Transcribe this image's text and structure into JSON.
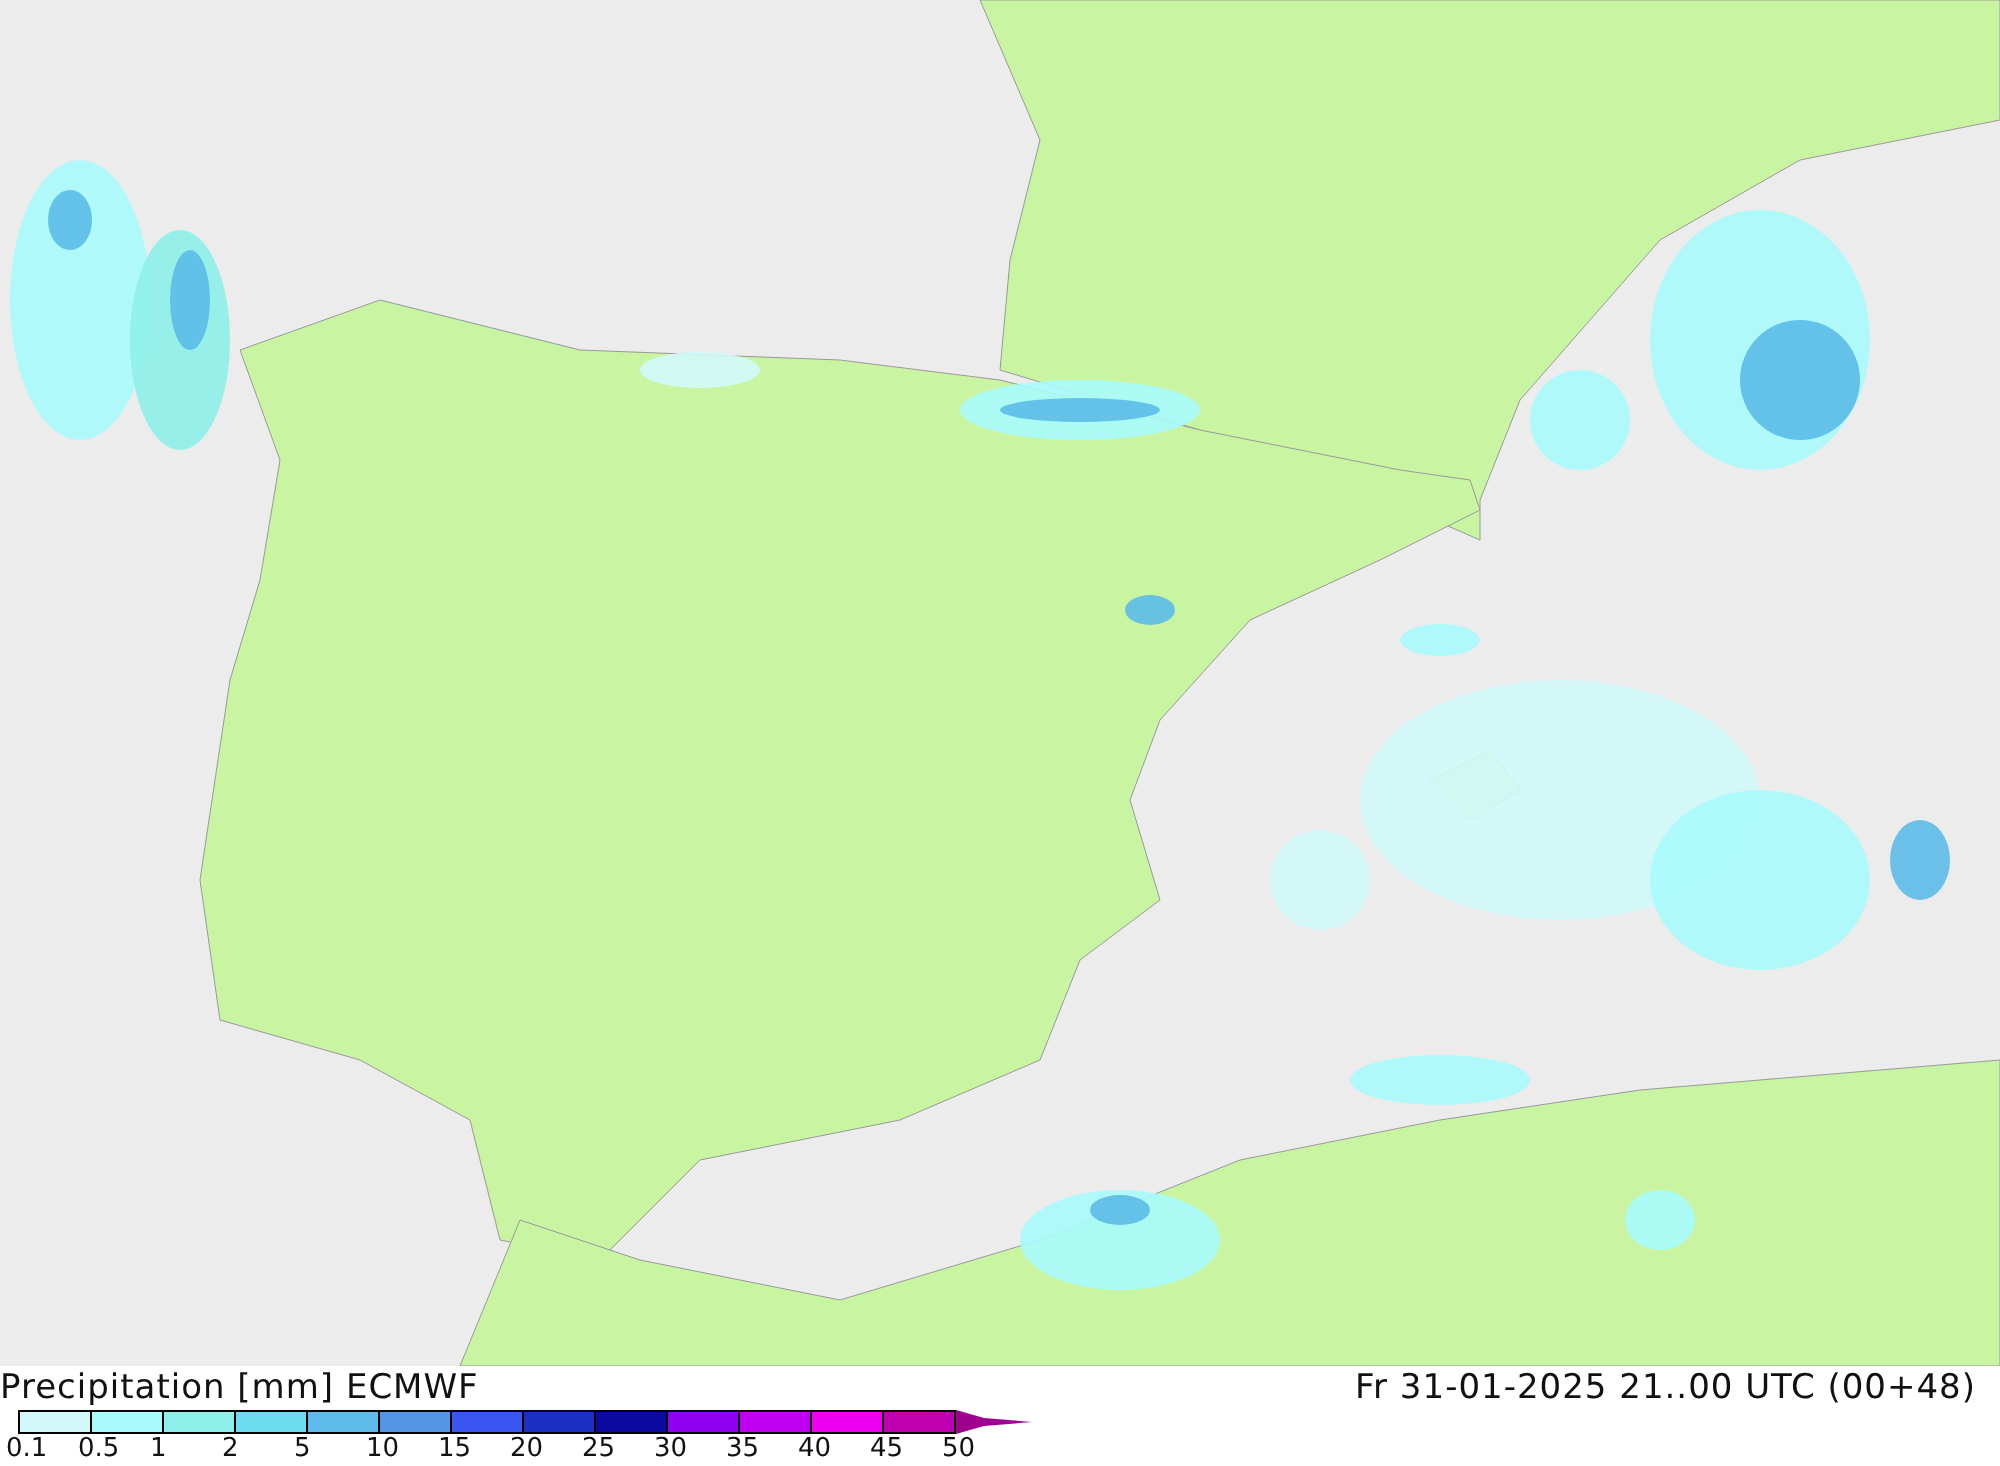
{
  "title": "Precipitation [mm] ECMWF",
  "valid_time": "Fr 31-01-2025 21..00 UTC (00+48)",
  "scale": {
    "swatches": [
      {
        "color": "#d2f8fa"
      },
      {
        "color": "#a8fbfd"
      },
      {
        "color": "#8ef0ea"
      },
      {
        "color": "#6cdcf0"
      },
      {
        "color": "#5cbbe8"
      },
      {
        "color": "#5396e6"
      },
      {
        "color": "#3a55f0"
      },
      {
        "color": "#1a30c0"
      },
      {
        "color": "#0a0aa0"
      },
      {
        "color": "#9000f0"
      },
      {
        "color": "#c000f0"
      },
      {
        "color": "#f000f0"
      },
      {
        "color": "#c000b0"
      }
    ],
    "labels": [
      "0.1",
      "0.5",
      "1",
      "2",
      "5",
      "10",
      "15",
      "20",
      "25",
      "30",
      "35",
      "40",
      "45",
      "50"
    ]
  }
}
